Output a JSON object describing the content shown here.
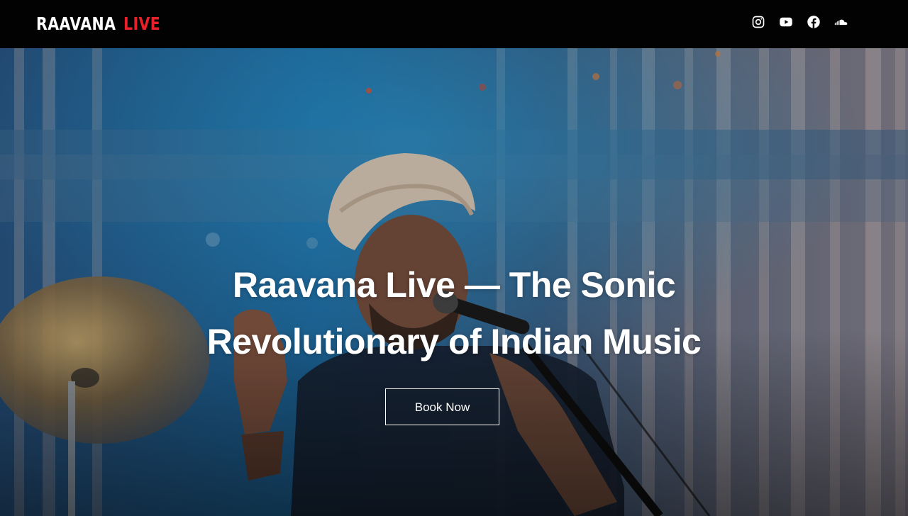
{
  "header": {
    "logo": {
      "word1": "RAAVANA",
      "word2": "LIVE",
      "colors": {
        "word1": "#ffffff",
        "word2": "#e8202a"
      }
    },
    "social_icons": [
      "instagram-icon",
      "youtube-icon",
      "facebook-icon",
      "soundcloud-icon"
    ]
  },
  "hero": {
    "title_line1": "Raavana Live — The Sonic",
    "title_line2": "Revolutionary of Indian Music",
    "cta_label": "Book Now",
    "image_description_icon": "concert-photo-background"
  },
  "colors": {
    "header_bg": "#020202",
    "accent_red": "#e8202a",
    "text": "#ffffff"
  }
}
